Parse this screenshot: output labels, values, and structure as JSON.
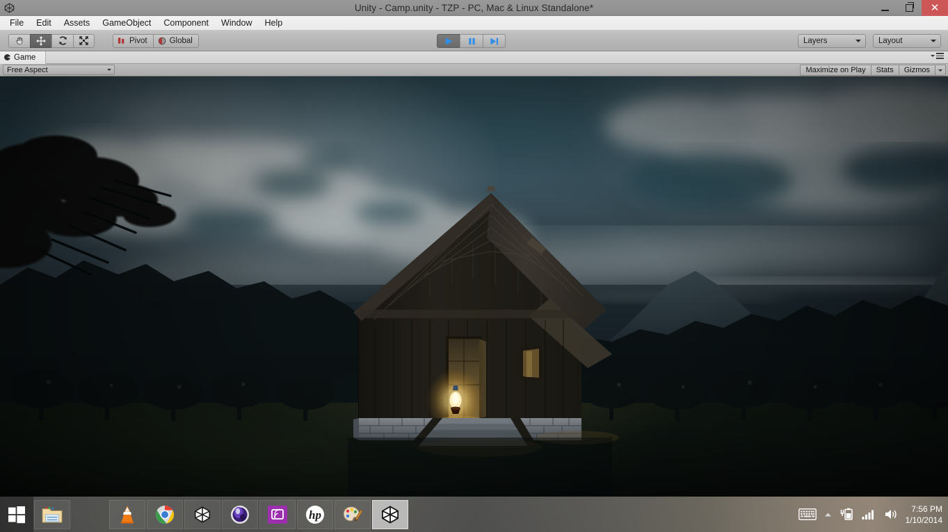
{
  "window": {
    "title": "Unity - Camp.unity - TZP - PC, Mac & Linux Standalone*",
    "app_icon": "unity-icon",
    "controls": {
      "minimize": "minimize-icon",
      "restore": "restore-icon",
      "close": "close-icon",
      "close_color": "#cd5656"
    }
  },
  "menubar": {
    "items": [
      {
        "label": "File"
      },
      {
        "label": "Edit"
      },
      {
        "label": "Assets"
      },
      {
        "label": "GameObject"
      },
      {
        "label": "Component"
      },
      {
        "label": "Window"
      },
      {
        "label": "Help"
      }
    ]
  },
  "toolbar": {
    "transform_tools": [
      {
        "name": "hand-tool",
        "icon": "hand-icon",
        "active": false
      },
      {
        "name": "move-tool",
        "icon": "move-arrows-icon",
        "active": true
      },
      {
        "name": "rotate-tool",
        "icon": "rotate-icon",
        "active": false
      },
      {
        "name": "scale-tool",
        "icon": "scale-icon",
        "active": false
      }
    ],
    "pivot_label": "Pivot",
    "pivot_icon": "pivot-icon",
    "global_label": "Global",
    "global_icon": "globe-icon",
    "play_controls": [
      {
        "name": "play-button",
        "icon": "play-icon",
        "engaged": true
      },
      {
        "name": "pause-button",
        "icon": "pause-icon",
        "engaged": false
      },
      {
        "name": "step-button",
        "icon": "step-icon",
        "engaged": false
      }
    ],
    "play_accent_color": "#2f8fe8",
    "layers_label": "Layers",
    "layout_label": "Layout"
  },
  "game_panel": {
    "tab_label": "Game",
    "tab_icon": "gamepad-icon",
    "aspect_label": "Free Aspect",
    "maximize_on_play_label": "Maximize on Play",
    "stats_label": "Stats",
    "gizmos_label": "Gizmos",
    "panel_menu_icon": "hamburger-menu-icon"
  },
  "scene": {
    "description": "Nighttime 3D game scene: a dark wooden cabin with a steep shingled gable roof, stone foundation and steps, a glowing oil lantern in the open doorway, silhouetted trees on the left and right, dark mountains on the horizon, and a dusk sky with teal patches and pale grey clouds.",
    "sky_top_color": "#2a4550",
    "sky_horizon_color": "#121a1e",
    "cloud_color": "#a9b0b4",
    "lantern_glow_color": "#ffd877",
    "cabin_wood_color": "#2a2620",
    "stone_color": "#6d7177",
    "ground_color": "#101710"
  },
  "taskbar": {
    "start_icon": "windows-start-icon",
    "items": [
      {
        "name": "taskbar-item-file-explorer",
        "icon": "folder-icon",
        "active": false
      },
      {
        "name": "taskbar-item-vlc",
        "icon": "vlc-cone-icon",
        "active": false
      },
      {
        "name": "taskbar-item-chrome",
        "icon": "chrome-icon",
        "active": false
      },
      {
        "name": "taskbar-item-unity",
        "icon": "unity-icon",
        "active": false
      },
      {
        "name": "taskbar-item-cinema4d",
        "icon": "cinema4d-icon",
        "active": false
      },
      {
        "name": "taskbar-item-screen-cast",
        "icon": "cast-screen-icon",
        "active": false
      },
      {
        "name": "taskbar-item-hp",
        "icon": "hp-icon",
        "active": false
      },
      {
        "name": "taskbar-item-paint",
        "icon": "paint-palette-icon",
        "active": false
      },
      {
        "name": "taskbar-item-unity-active",
        "icon": "unity-icon",
        "active": true
      }
    ],
    "tray": {
      "keyboard_icon": "keyboard-icon",
      "show_hidden_icon": "chevron-up-icon",
      "battery_icon": "battery-charging-icon",
      "network_icon": "wifi-bars-icon",
      "volume_icon": "speaker-icon",
      "time": "7:56 PM",
      "date": "1/10/2014"
    }
  }
}
